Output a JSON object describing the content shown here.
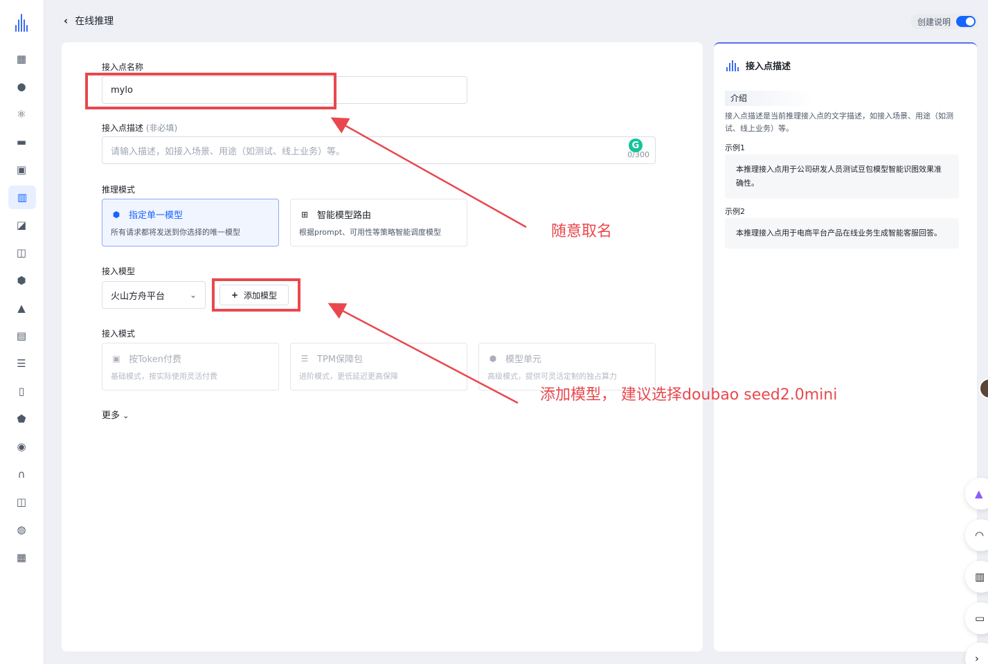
{
  "topbar": {
    "back_label": "在线推理",
    "guide_label": "创建说明"
  },
  "form": {
    "name_label": "接入点名称",
    "name_value": "mylo",
    "desc_label": "接入点描述",
    "desc_optional": "(非必填)",
    "desc_placeholder": "请输入描述，如接入场景、用途（如测试、线上业务）等。",
    "desc_counter": "0/300",
    "infer_mode_label": "推理模式",
    "infer_modes": [
      {
        "title": "指定单一模型",
        "desc": "所有请求都将发送到你选择的唯一模型"
      },
      {
        "title": "智能模型路由",
        "desc": "根据prompt、可用性等策略智能调度模型"
      }
    ],
    "model_label": "接入模型",
    "platform_value": "火山方舟平台",
    "add_model_label": "添加模型",
    "access_mode_label": "接入模式",
    "access_modes": [
      {
        "title": "按Token付费",
        "desc": "基础模式，按实际使用灵活付费"
      },
      {
        "title": "TPM保障包",
        "desc": "进阶模式，更低延迟更高保障"
      },
      {
        "title": "模型单元",
        "desc": "高级模式，提供可灵活定制的独占算力"
      }
    ],
    "more_label": "更多"
  },
  "panel": {
    "title": "接入点描述",
    "intro_tag": "介绍",
    "intro_text": "接入点描述是当前推理接入点的文字描述，如接入场景、用途（如测试、线上业务）等。",
    "example1_label": "示例1",
    "example1_text": "本推理接入点用于公司研发人员测试豆包模型智能识图效果准确性。",
    "example2_label": "示例2",
    "example2_text": "本推理接入点用于电商平台产品在线业务生成智能客服回答。"
  },
  "annotations": {
    "name_hint": "随意取名",
    "model_hint": "添加模型， 建议选择doubao seed2.0mini"
  },
  "colors": {
    "accent": "#1664ff",
    "annotation": "#e8484d"
  }
}
